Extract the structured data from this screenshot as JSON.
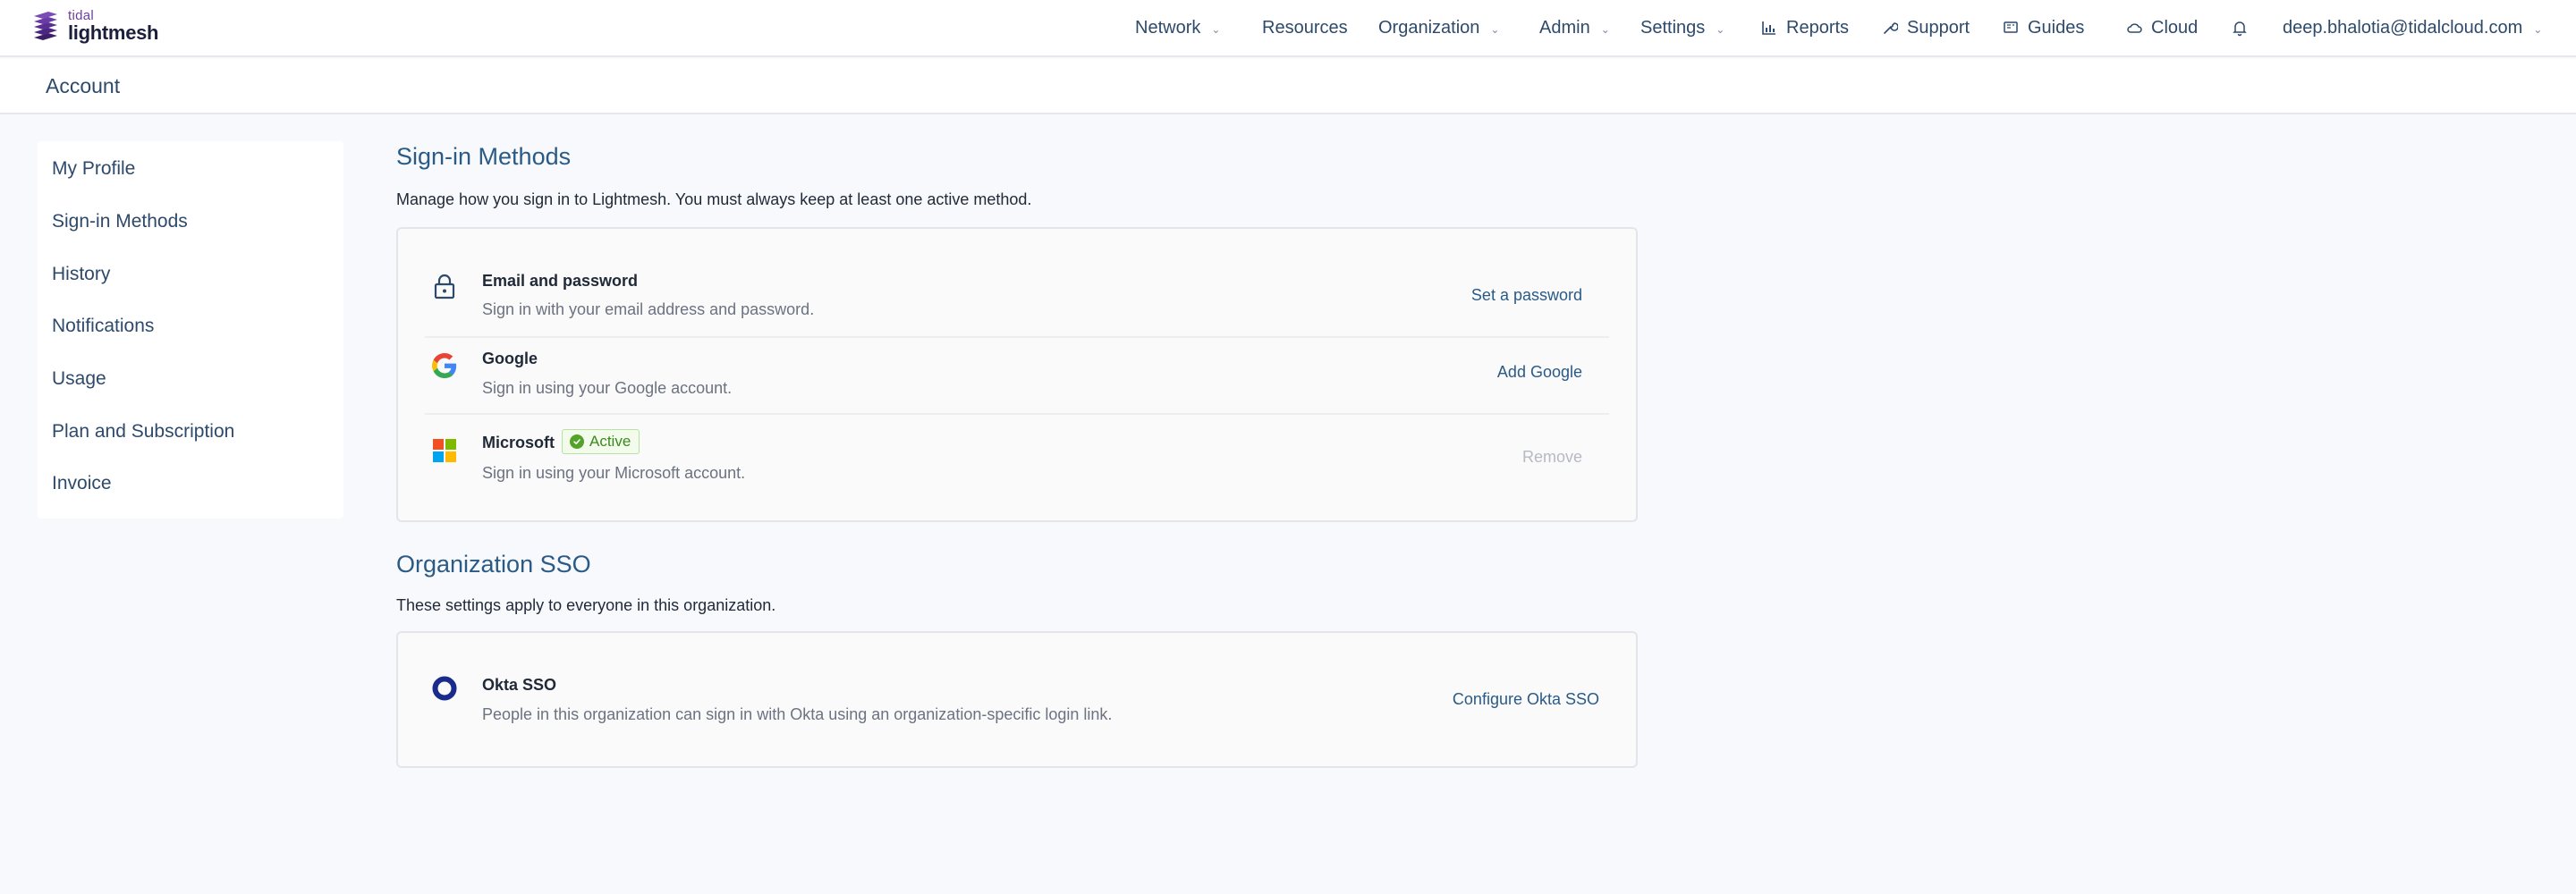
{
  "brand": {
    "small": "tidal",
    "name": "lightmesh"
  },
  "nav": {
    "network": "Network",
    "resources": "Resources",
    "organization": "Organization",
    "admin": "Admin",
    "settings": "Settings",
    "reports": "Reports",
    "support": "Support",
    "guides": "Guides",
    "cloud": "Cloud",
    "user_email": "deep.bhalotia@tidalcloud.com"
  },
  "account_bar": {
    "title": "Account"
  },
  "sidebar": {
    "items": [
      {
        "label": "My Profile"
      },
      {
        "label": "Sign-in Methods"
      },
      {
        "label": "History"
      },
      {
        "label": "Notifications"
      },
      {
        "label": "Usage"
      },
      {
        "label": "Plan and Subscription"
      },
      {
        "label": "Invoice"
      }
    ]
  },
  "signin": {
    "title": "Sign-in Methods",
    "description": "Manage how you sign in to Lightmesh. You must always keep at least one active method.",
    "methods": [
      {
        "icon": "lock-icon",
        "name": "Email and password",
        "subtitle": "Sign in with your email address and password.",
        "action": "Set a password"
      },
      {
        "icon": "google-icon",
        "name": "Google",
        "subtitle": "Sign in using your Google account.",
        "action": "Add Google"
      },
      {
        "icon": "microsoft-icon",
        "name": "Microsoft",
        "badge": "Active",
        "subtitle": "Sign in using your Microsoft account.",
        "action": "Remove"
      }
    ]
  },
  "org_sso": {
    "title": "Organization SSO",
    "description": "These settings apply to everyone in this organization.",
    "provider": {
      "icon": "okta-icon",
      "name": "Okta SSO",
      "subtitle": "People in this organization can sign in with Okta using an organization-specific login link.",
      "action": "Configure Okta SSO"
    }
  },
  "colors": {
    "accent": "#2a5a86",
    "nav_text": "#2d4a6b",
    "active_green": "#52a22c",
    "okta_blue": "#1a2b8c",
    "background": "#f8f9fc"
  }
}
